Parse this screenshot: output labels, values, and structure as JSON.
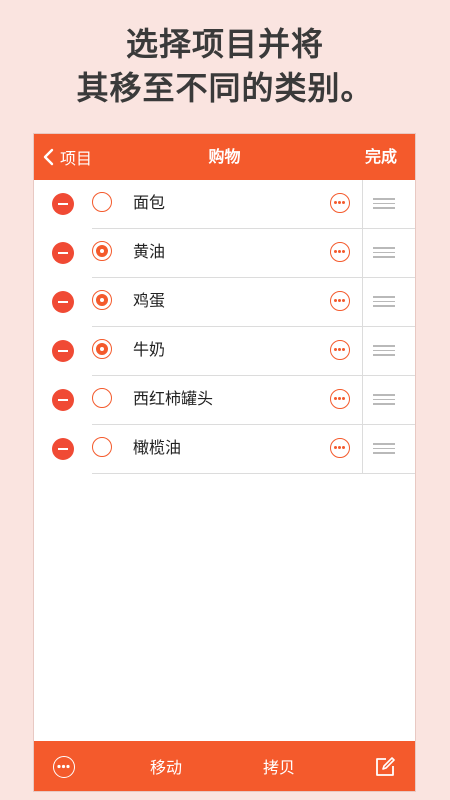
{
  "headline": {
    "line1": "选择项目并将",
    "line2": "其移至不同的类别。"
  },
  "navbar": {
    "back_label": "项目",
    "title": "购物",
    "done_label": "完成"
  },
  "items": [
    {
      "name": "面包",
      "selected": false
    },
    {
      "name": "黄油",
      "selected": true
    },
    {
      "name": "鸡蛋",
      "selected": true
    },
    {
      "name": "牛奶",
      "selected": true
    },
    {
      "name": "西红柿罐头",
      "selected": false
    },
    {
      "name": "橄榄油",
      "selected": false
    }
  ],
  "toolbar": {
    "move_label": "移动",
    "copy_label": "拷贝"
  },
  "colors": {
    "accent": "#f45a2c",
    "delete": "#f04a34",
    "background": "#fae4e0"
  },
  "icons": {
    "back": "chevron-left-icon",
    "delete": "minus-circle-icon",
    "more": "ellipsis-circle-icon",
    "reorder": "drag-handle-icon",
    "edit": "compose-icon"
  }
}
